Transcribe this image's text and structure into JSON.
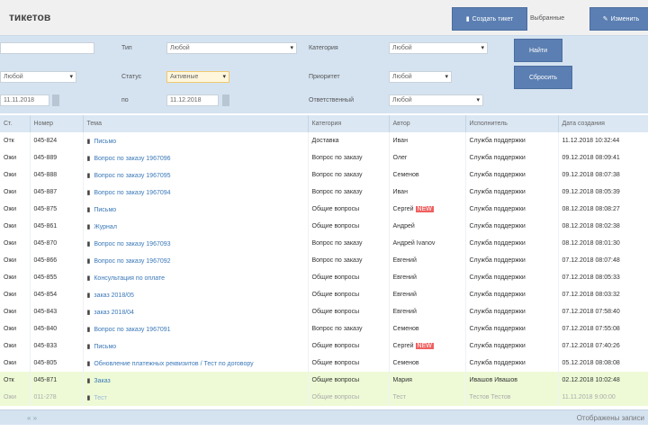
{
  "header": {
    "title": "тикетов",
    "create_btn": "Создать тикет",
    "selected_label": "Выбранные",
    "edit_btn": "Изменить"
  },
  "filters": {
    "search_value": "",
    "row2_value": "Любой",
    "date_from": "11.11.2018",
    "type_label": "Тип",
    "type_value": "Любой",
    "status_label": "Статус",
    "status_value": "Активные",
    "to_label": "по",
    "date_to": "11.12.2018",
    "category_label": "Категория",
    "category_value": "Любой",
    "priority_label": "Приоритет",
    "priority_value": "Любой",
    "assignee_label": "Ответственный",
    "assignee_value": "Любой",
    "find_btn": "Найти",
    "reset_btn": "Сбросить"
  },
  "columns": [
    "Ст.",
    "Номер",
    "Тема",
    "Категория",
    "Автор",
    "Исполнитель",
    "Дата создания"
  ],
  "rows": [
    {
      "st": "Отк",
      "num": "045-824",
      "subj": "Письмо",
      "cat": "Доставка",
      "author": "Иван",
      "exec": "Служба поддержки",
      "date": "11.12.2018 10:32:44"
    },
    {
      "st": "Ожи",
      "num": "045-889",
      "subj": "Вопрос по заказу 1967096",
      "cat": "Вопрос по заказу",
      "author": "Олег",
      "exec": "Служба поддержки",
      "date": "09.12.2018 08:09:41"
    },
    {
      "st": "Ожи",
      "num": "045-888",
      "subj": "Вопрос по заказу 1967095",
      "cat": "Вопрос по заказу",
      "author": "Семенов",
      "exec": "Служба поддержки",
      "date": "09.12.2018 08:07:38"
    },
    {
      "st": "Ожи",
      "num": "045-887",
      "subj": "Вопрос по заказу 1967094",
      "cat": "Вопрос по заказу",
      "author": "Иван",
      "exec": "Служба поддержки",
      "date": "09.12.2018 08:05:39"
    },
    {
      "st": "Ожи",
      "num": "045-875",
      "subj": "Письмо",
      "cat": "Общие вопросы",
      "author": "Сергей",
      "badge": "NEW",
      "exec": "Служба поддержки",
      "date": "08.12.2018 08:08:27"
    },
    {
      "st": "Ожи",
      "num": "045-861",
      "subj": "Журнал",
      "cat": "Общие вопросы",
      "author": "Андрей",
      "exec": "Служба поддержки",
      "date": "08.12.2018 08:02:38"
    },
    {
      "st": "Ожи",
      "num": "045-870",
      "subj": "Вопрос по заказу 1967093",
      "cat": "Вопрос по заказу",
      "author": "Андрей Ivanov",
      "exec": "Служба поддержки",
      "date": "08.12.2018 08:01:30"
    },
    {
      "st": "Ожи",
      "num": "045-866",
      "subj": "Вопрос по заказу 1967092",
      "cat": "Вопрос по заказу",
      "author": "Евгений",
      "exec": "Служба поддержки",
      "date": "07.12.2018 08:07:48"
    },
    {
      "st": "Ожи",
      "num": "045-855",
      "subj": "Консультация по оплате",
      "cat": "Общие вопросы",
      "author": "Евгений",
      "exec": "Служба поддержки",
      "date": "07.12.2018 08:05:33"
    },
    {
      "st": "Ожи",
      "num": "045-854",
      "subj": "заказ 2018/05",
      "cat": "Общие вопросы",
      "author": "Евгений",
      "exec": "Служба поддержки",
      "date": "07.12.2018 08:03:32"
    },
    {
      "st": "Ожи",
      "num": "045-843",
      "subj": "заказ 2018/04",
      "cat": "Общие вопросы",
      "author": "Евгений",
      "exec": "Служба поддержки",
      "date": "07.12.2018 07:58:40"
    },
    {
      "st": "Ожи",
      "num": "045-840",
      "subj": "Вопрос по заказу 1967091",
      "cat": "Вопрос по заказу",
      "author": "Семенов",
      "exec": "Служба поддержки",
      "date": "07.12.2018 07:55:08"
    },
    {
      "st": "Ожи",
      "num": "045-833",
      "subj": "Письмо",
      "cat": "Общие вопросы",
      "author": "Сергей",
      "badge": "NEW",
      "exec": "Служба поддержки",
      "date": "07.12.2018 07:40:26"
    },
    {
      "st": "Ожи",
      "num": "045-805",
      "subj": "Обновление платежных реквизитов / Тест по договору",
      "cat": "Общие вопросы",
      "author": "Семенов",
      "exec": "Служба поддержки",
      "date": "05.12.2018 08:08:08"
    },
    {
      "st": "Отк",
      "num": "045-871",
      "subj": "Заказ",
      "cat": "Общие вопросы",
      "author": "Мария",
      "exec": "Ивашов Ивашов",
      "date": "02.12.2018 10:02:48",
      "hl": "g"
    },
    {
      "st": "Ожи",
      "num": "011-278",
      "subj": "Тест",
      "cat": "Общие вопросы",
      "author": "Тест",
      "exec": "Тестов Тестов",
      "date": "11.11.2018 9:00:00",
      "hl": "g2"
    }
  ],
  "footer": {
    "pager": "« »",
    "summary": "Отображены записи"
  }
}
